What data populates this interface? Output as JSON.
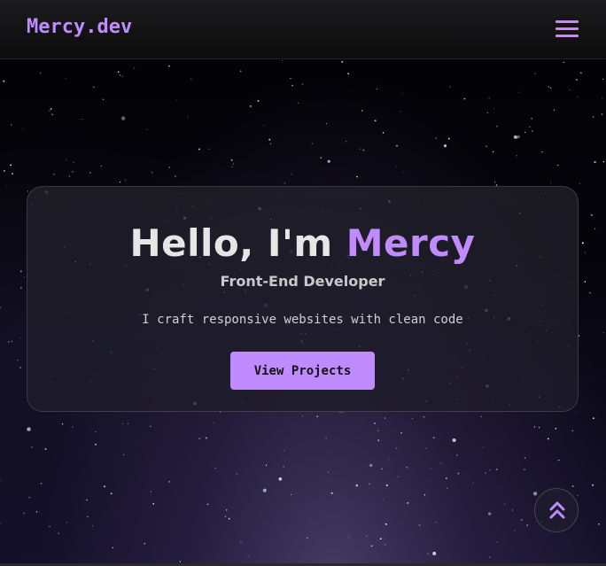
{
  "navbar": {
    "logo": "Mercy.dev",
    "menu_icon": "hamburger-menu-icon"
  },
  "hero": {
    "greeting": "Hello, I'm",
    "name": "Mercy",
    "subtitle": "Front-End Developer",
    "tagline": "I craft responsive websites with clean code",
    "cta_label": "View Projects"
  },
  "scroll_top": {
    "icon": "double-chevron-up-icon"
  },
  "colors": {
    "accent": "#bf8bff",
    "navbar_bg": "#121214",
    "card_bg": "#22212a",
    "text": "#e6e6e6"
  }
}
